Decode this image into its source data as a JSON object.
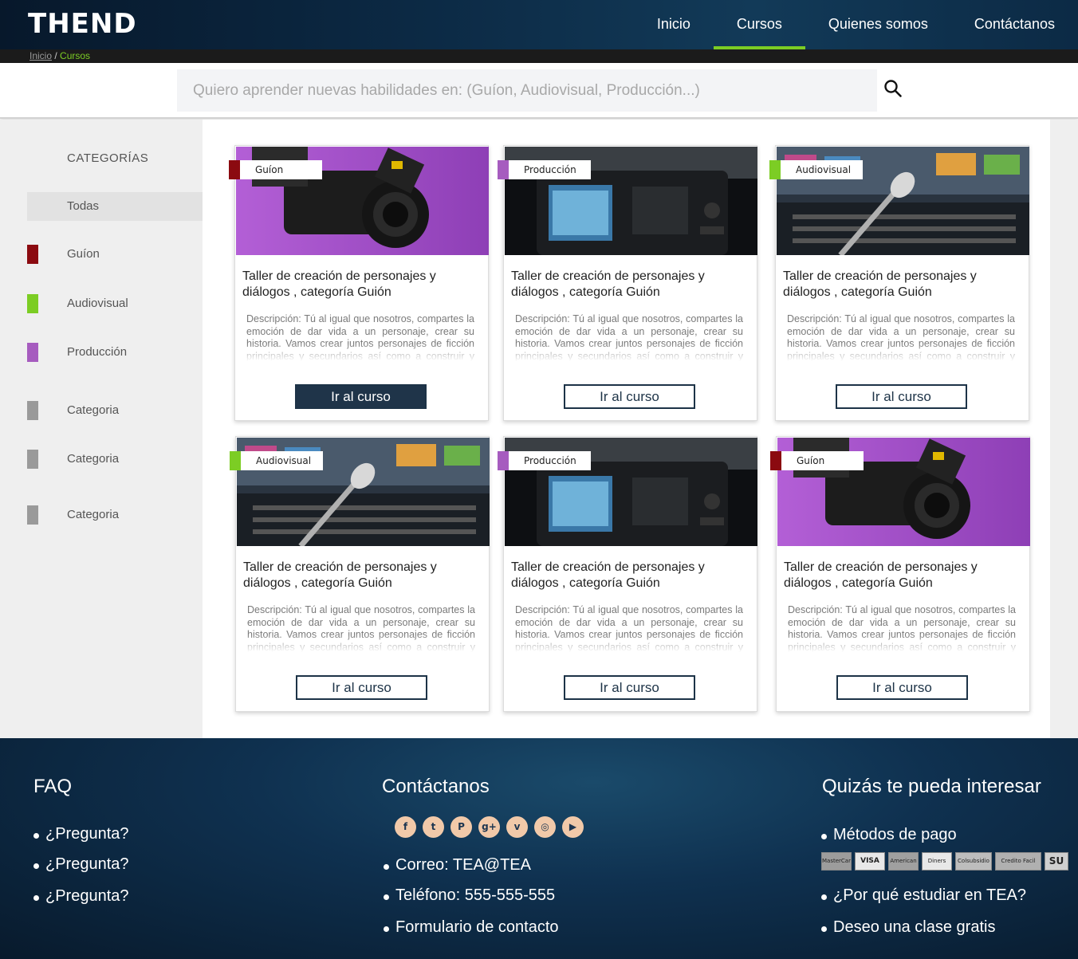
{
  "header": {
    "logo": "THEND",
    "nav": [
      {
        "label": "Inicio",
        "active": false
      },
      {
        "label": "Cursos",
        "active": true
      },
      {
        "label": "Quienes somos",
        "active": false
      },
      {
        "label": "Contáctanos",
        "active": false
      }
    ]
  },
  "breadcrumb": {
    "home": "Inicio",
    "sep": " / ",
    "current": "Cursos"
  },
  "search": {
    "placeholder": "Quiero aprender nuevas habilidades en: (Guíon, Audiovisual, Producción...)"
  },
  "sidebar": {
    "title": "CATEGORÍAS",
    "items": [
      {
        "label": "Todas",
        "color": ""
      },
      {
        "label": "Guíon",
        "color": "#8b0a10"
      },
      {
        "label": "Audiovisual",
        "color": "#7ccd24"
      },
      {
        "label": "Producción",
        "color": "#a65cbf"
      },
      {
        "label": "Categoria",
        "color": "#9a9a9a"
      },
      {
        "label": "Categoria",
        "color": "#9a9a9a"
      },
      {
        "label": "Categoria",
        "color": "#9a9a9a"
      }
    ]
  },
  "cards": [
    {
      "tag": "Guíon",
      "tag_color": "#8b0a10",
      "image": "camera-purple",
      "title": "Taller de creación de personajes y diálogos , categoría Guión",
      "desc": "Descripción: Tú al igual que nosotros, compartes la emoción de dar vida a un personaje, crear su historia. Vamos crear juntos personajes de ficción principales y secundarios así como a construir y ubicar diálogos mediante el desarrollo de un",
      "button": "Ir al curso",
      "button_filled": true
    },
    {
      "tag": "Producción",
      "tag_color": "#a65cbf",
      "image": "camera-screen",
      "title": "Taller de creación de personajes y diálogos , categoría Guión",
      "desc": "Descripción: Tú al igual que nosotros, compartes la emoción de dar vida a un personaje, crear su historia. Vamos crear juntos personajes de ficción principales y secundarios así como a construir y ubicar diálogos mediante el desarrollo de un",
      "button": "Ir al curso",
      "button_filled": false
    },
    {
      "tag": "Audiovisual",
      "tag_color": "#7ccd24",
      "image": "microphone-studio",
      "title": "Taller de creación de personajes y diálogos , categoría Guión",
      "desc": "Descripción: Tú al igual que nosotros, compartes la emoción de dar vida a un personaje, crear su historia. Vamos crear juntos personajes de ficción principales y secundarios así como a construir y ubicar diálogos mediante el desarrollo de un",
      "button": "Ir al curso",
      "button_filled": false
    },
    {
      "tag": "Audiovisual",
      "tag_color": "#7ccd24",
      "image": "microphone-studio",
      "title": "Taller de creación de personajes y diálogos , categoría Guión",
      "desc": "Descripción: Tú al igual que nosotros, compartes la emoción de dar vida a un personaje, crear su historia. Vamos crear juntos personajes de ficción principales y secundarios así como a construir y ubicar diálogos mediante el desarrollo de un",
      "button": "Ir al curso",
      "button_filled": false
    },
    {
      "tag": "Producción",
      "tag_color": "#a65cbf",
      "image": "camera-screen",
      "title": "Taller de creación de personajes y diálogos , categoría Guión",
      "desc": "Descripción: Tú al igual que nosotros, compartes la emoción de dar vida a un personaje, crear su historia. Vamos crear juntos personajes de ficción principales y secundarios así como a construir y ubicar diálogos mediante el desarrollo de un",
      "button": "Ir al curso",
      "button_filled": false
    },
    {
      "tag": "Guíon",
      "tag_color": "#8b0a10",
      "image": "camera-purple",
      "title": "Taller de creación de personajes y diálogos , categoría Guión",
      "desc": "Descripción: Tú al igual que nosotros, compartes la emoción de dar vida a un personaje, crear su historia. Vamos crear juntos personajes de ficción principales y secundarios así como a construir y ubicar diálogos mediante el desarrollo de un",
      "button": "Ir al curso",
      "button_filled": false
    }
  ],
  "footer": {
    "faq": {
      "title": "FAQ",
      "items": [
        "¿Pregunta?",
        "¿Pregunta?",
        "¿Pregunta?"
      ]
    },
    "contact": {
      "title": "Contáctanos",
      "social": [
        "facebook-icon",
        "twitter-icon",
        "pinterest-icon",
        "google-plus-icon",
        "vimeo-icon",
        "instagram-icon",
        "youtube-icon"
      ],
      "items": [
        "Correo: TEA@TEA",
        "Teléfono: 555-555-555",
        "Formulario de contacto"
      ]
    },
    "interest": {
      "title": "Quizás te pueda interesar",
      "items": [
        "Métodos de pago",
        "¿Por qué estudiar en TEA?",
        "Deseo una clase gratis"
      ],
      "payments": [
        "MasterCard",
        "VISA",
        "American Express",
        "Diners Club",
        "Colsubsidio",
        "Credito Facil Codensa",
        "SU"
      ]
    }
  }
}
